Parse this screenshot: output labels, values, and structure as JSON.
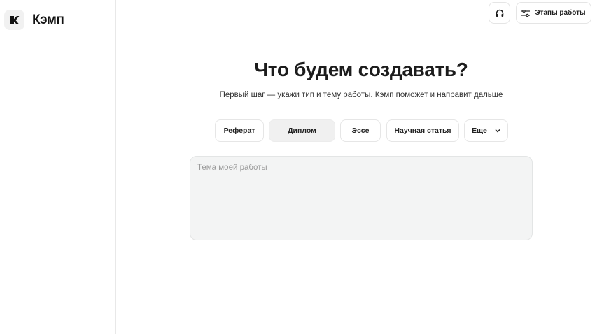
{
  "app": {
    "name": "Кэмп"
  },
  "header": {
    "support_icon": "headphones-icon",
    "stages_icon": "sliders-icon",
    "stages_label": "Этапы работы"
  },
  "main": {
    "title": "Что будем создавать?",
    "subtitle": "Первый шаг — укажи тип и тему работы. Кэмп поможет и направит дальше",
    "types": [
      {
        "label": "Реферат",
        "selected": false
      },
      {
        "label": "Диплом",
        "selected": true
      },
      {
        "label": "Эссе",
        "selected": false
      },
      {
        "label": "Научная статья",
        "selected": false
      }
    ],
    "more": {
      "label": "Еще",
      "icon": "chevron-down-icon"
    },
    "topic": {
      "placeholder": "Тема моей работы",
      "value": ""
    }
  }
}
